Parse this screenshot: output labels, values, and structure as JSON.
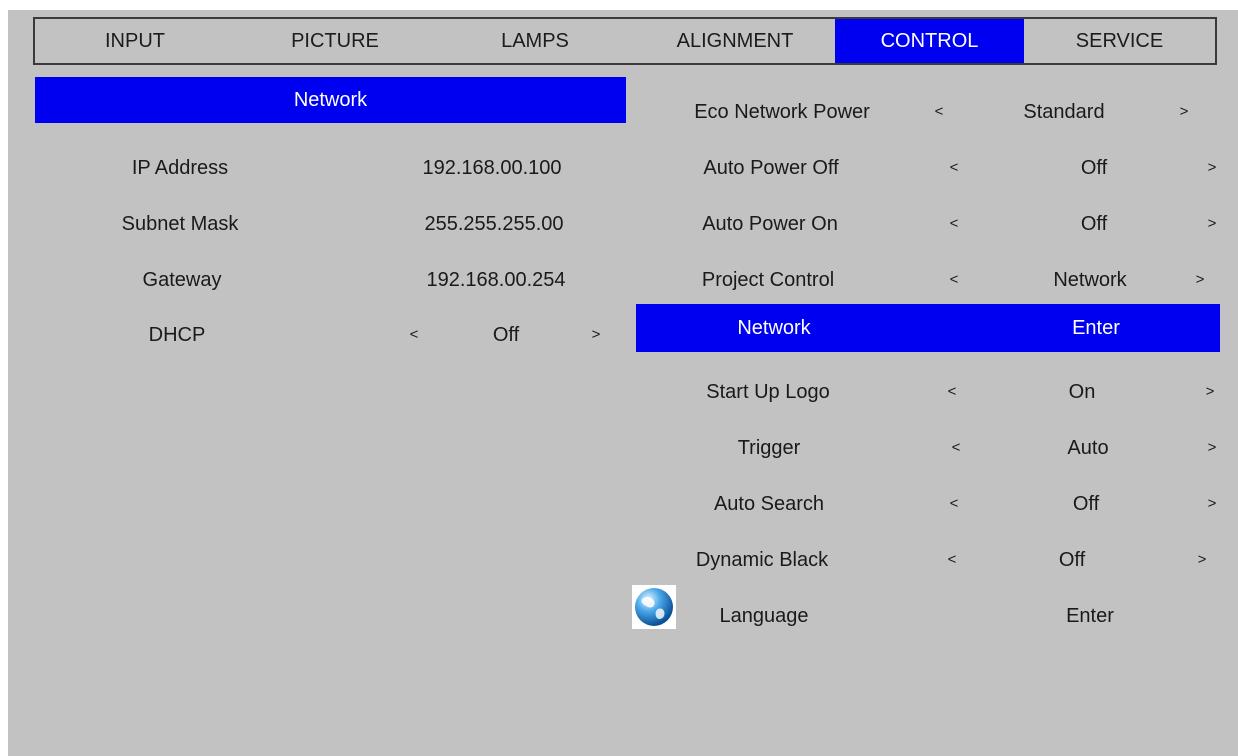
{
  "tabs": [
    {
      "label": "INPUT"
    },
    {
      "label": "PICTURE"
    },
    {
      "label": "LAMPS"
    },
    {
      "label": "ALIGNMENT"
    },
    {
      "label": "CONTROL"
    },
    {
      "label": "SERVICE"
    }
  ],
  "active_tab": "CONTROL",
  "network_panel": {
    "header": "Network",
    "ip_address": {
      "label": "IP Address",
      "value": "192.168.00.100"
    },
    "subnet_mask": {
      "label": "Subnet Mask",
      "value": "255.255.255.00"
    },
    "gateway": {
      "label": "Gateway",
      "value": "192.168.00.254"
    },
    "dhcp": {
      "label": "DHCP",
      "value": "Off"
    }
  },
  "arrows": {
    "left": "<",
    "right": ">"
  },
  "control_panel": {
    "eco_network_power": {
      "label": "Eco Network Power",
      "value": "Standard"
    },
    "auto_power_off": {
      "label": "Auto Power Off",
      "value": "Off"
    },
    "auto_power_on": {
      "label": "Auto Power On",
      "value": "Off"
    },
    "project_control": {
      "label": "Project Control",
      "value": "Network"
    },
    "network": {
      "label": "Network",
      "value": "Enter"
    },
    "start_up_logo": {
      "label": "Start Up Logo",
      "value": "On"
    },
    "trigger": {
      "label": "Trigger",
      "value": "Auto"
    },
    "auto_search": {
      "label": "Auto Search",
      "value": "Off"
    },
    "dynamic_black": {
      "label": "Dynamic Black",
      "value": "Off"
    },
    "language": {
      "label": "Language",
      "value": "Enter",
      "icon": "globe-icon"
    }
  },
  "colors": {
    "highlight": "#0000f0",
    "background": "#c2c2c2",
    "text": "#1a1a1a"
  }
}
